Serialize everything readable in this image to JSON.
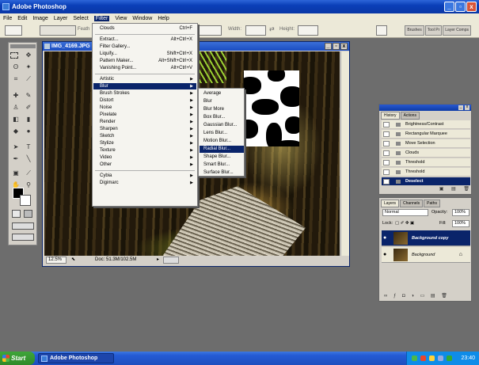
{
  "app": {
    "title": "Adobe Photoshop"
  },
  "window_controls": {
    "min": "_",
    "max": "▫",
    "close": "x"
  },
  "menubar": [
    "File",
    "Edit",
    "Image",
    "Layer",
    "Select",
    "Filter",
    "View",
    "Window",
    "Help"
  ],
  "options_bar": {
    "feather_label": "Feath",
    "width_label": "Width:",
    "height_label": "Height:",
    "swap": "⇄"
  },
  "palette_well": [
    "Brushes",
    "Tool Pr",
    "Layer Comps"
  ],
  "document": {
    "title": "IMG_4169.JPG",
    "zoom": "12.5%",
    "doc_info": "Doc: 51.3M/102.5M"
  },
  "filter_menu": [
    {
      "label": "Clouds",
      "shortcut": "Ctrl+F"
    },
    {
      "sep": true
    },
    {
      "label": "Extract...",
      "shortcut": "Alt+Ctrl+X"
    },
    {
      "label": "Filter Gallery...",
      "shortcut": ""
    },
    {
      "label": "Liquify...",
      "shortcut": "Shift+Ctrl+X"
    },
    {
      "label": "Pattern Maker...",
      "shortcut": "Alt+Shift+Ctrl+X"
    },
    {
      "label": "Vanishing Point...",
      "shortcut": "Alt+Ctrl+V"
    },
    {
      "sep": true
    },
    {
      "label": "Artistic",
      "submenu": true
    },
    {
      "label": "Blur",
      "submenu": true,
      "highlight": true
    },
    {
      "label": "Brush Strokes",
      "submenu": true
    },
    {
      "label": "Distort",
      "submenu": true
    },
    {
      "label": "Noise",
      "submenu": true
    },
    {
      "label": "Pixelate",
      "submenu": true
    },
    {
      "label": "Render",
      "submenu": true
    },
    {
      "label": "Sharpen",
      "submenu": true
    },
    {
      "label": "Sketch",
      "submenu": true
    },
    {
      "label": "Stylize",
      "submenu": true
    },
    {
      "label": "Texture",
      "submenu": true
    },
    {
      "label": "Video",
      "submenu": true
    },
    {
      "label": "Other",
      "submenu": true
    },
    {
      "sep": true
    },
    {
      "label": "Cybia",
      "submenu": true
    },
    {
      "label": "Digimarc",
      "submenu": true
    }
  ],
  "blur_submenu": [
    {
      "label": "Average"
    },
    {
      "label": "Blur"
    },
    {
      "label": "Blur More"
    },
    {
      "label": "Box Blur..."
    },
    {
      "label": "Gaussian Blur..."
    },
    {
      "label": "Lens Blur..."
    },
    {
      "label": "Motion Blur..."
    },
    {
      "label": "Radial Blur...",
      "highlight": true
    },
    {
      "label": "Shape Blur..."
    },
    {
      "label": "Smart Blur..."
    },
    {
      "label": "Surface Blur..."
    }
  ],
  "history_palette": {
    "tabs": [
      "History",
      "Actions"
    ],
    "items": [
      "Brightness/Contrast",
      "Rectangular Marquee",
      "Move Selection",
      "Clouds",
      "Threshold",
      "Threshold",
      "Deselect"
    ],
    "selected_index": 6,
    "footer_icons": [
      "new-snapshot-icon",
      "new-document-icon",
      "trash-icon"
    ]
  },
  "layers_palette": {
    "tabs": [
      "Layers",
      "Channels",
      "Paths"
    ],
    "blend_mode": "Normal",
    "opacity_label": "Opacity:",
    "opacity": "100%",
    "lock_label": "Lock:",
    "fill_label": "Fill:",
    "fill": "100%",
    "layers": [
      {
        "name": "Background copy",
        "selected": true
      },
      {
        "name": "Background",
        "selected": false,
        "locked": true
      }
    ]
  },
  "taskbar": {
    "start": "Start",
    "task": "Adobe Photoshop",
    "clock": "23:40"
  },
  "colors": {
    "selection": "#0a246a",
    "xp_title": "#0a3fb8",
    "menu_bg": "#f5f4ef",
    "workspace": "#6d6d6d"
  }
}
